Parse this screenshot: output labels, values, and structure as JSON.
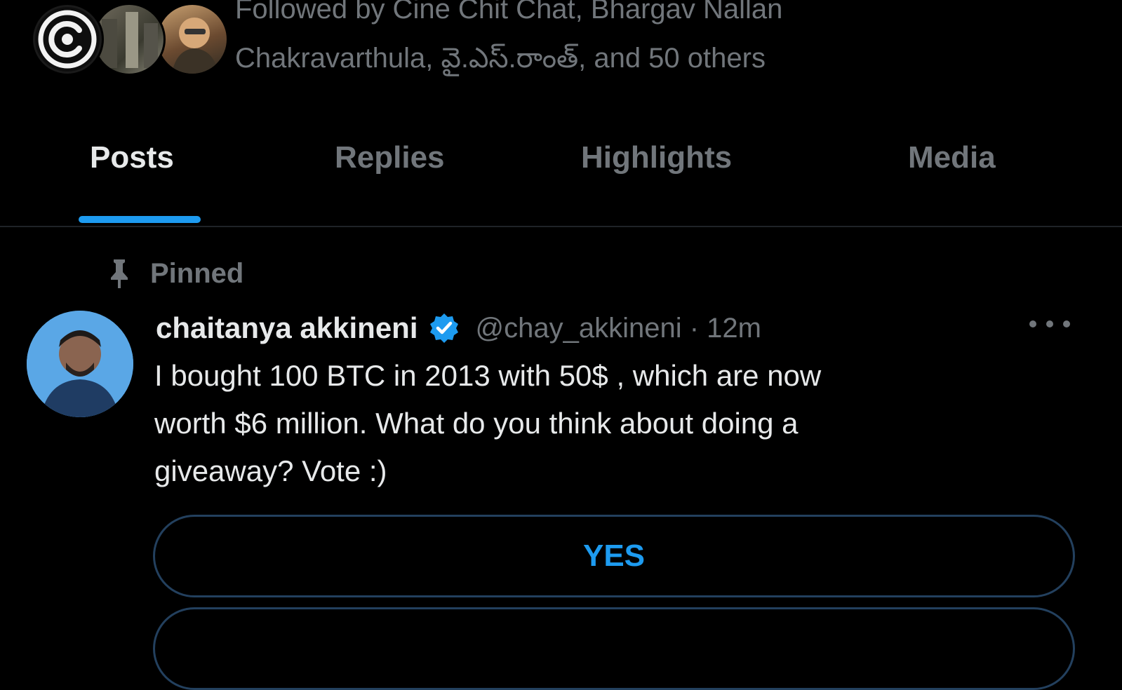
{
  "profile": {
    "followed_by": {
      "line1": "Followed by Cine Chit Chat, Bhargav Nallan",
      "line2": "Chakravarthula, వై.ఎస్.రాంత్, and 50 others"
    },
    "follower_avatars": [
      "avatar-logo",
      "avatar-photo",
      "avatar-photo"
    ]
  },
  "tabs": [
    {
      "label": "Posts",
      "active": true
    },
    {
      "label": "Replies",
      "active": false
    },
    {
      "label": "Highlights",
      "active": false
    },
    {
      "label": "Media",
      "active": false
    }
  ],
  "pinned": {
    "icon": "pin-icon",
    "label": "Pinned"
  },
  "post": {
    "author_name": "chaitanya akkineni",
    "verified_icon": "verified-badge-icon",
    "handle_time": "@chay_akkineni · 12m",
    "more_icon": "more-dots-icon",
    "text_lines": [
      "I bought 100 BTC in 2013 with 50$ , which are now",
      "worth $6 million. What do you think about doing a",
      "giveaway? Vote :)"
    ],
    "poll": {
      "options": [
        "YES"
      ]
    }
  },
  "colors": {
    "background": "#000000",
    "accent": "#1d9bf0",
    "muted_text": "#71767b",
    "primary_text": "#e7e9ea",
    "poll_border": "#23405e"
  }
}
